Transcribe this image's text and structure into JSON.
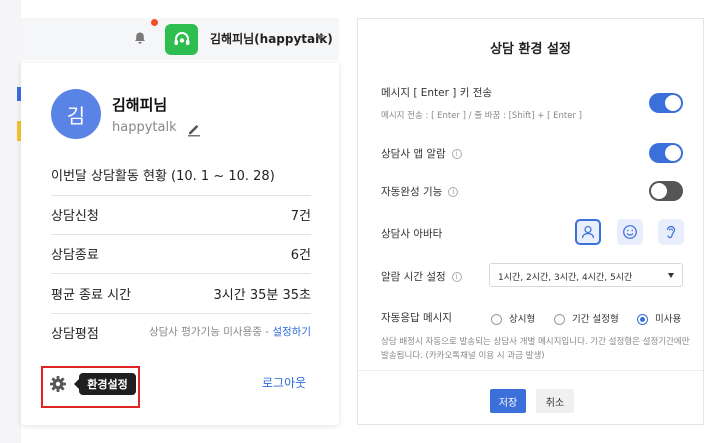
{
  "colors": {
    "accent": "#3b6fd9",
    "talk_green": "#2dbe4f",
    "notification_dot": "#f04e2a",
    "highlight_border": "#e02424",
    "link": "#2b6cd6"
  },
  "header": {
    "user_label": "김해피님(happytalk)",
    "notification_icon": "bell-icon",
    "logo_icon": "headset-icon"
  },
  "profile": {
    "avatar_text": "김",
    "name": "김해피님",
    "id": "happytalk",
    "activity_title": "이번달 상담활동 현황 (10. 1 ~ 10. 28)",
    "stats": [
      {
        "label": "상담신청",
        "value": "7건"
      },
      {
        "label": "상담종료",
        "value": "6건"
      },
      {
        "label": "평균 종료 시간",
        "value": "3시간 35분 35초"
      }
    ],
    "evaluation": {
      "label": "상담평점",
      "note": "상담사 평가기능 미사용중 - ",
      "link": "설정하기"
    },
    "settings_tooltip": "환경설정",
    "logout": "로그아웃"
  },
  "settings_modal": {
    "title": "상담 환경 설정",
    "enter_send": {
      "label": "메시지 [ Enter ] 키 전송",
      "sub": "메시지 전송 : [ Enter ] / 줄 바꿈 : [Shift] + [ Enter ]",
      "enabled": true
    },
    "app_alarm": {
      "label": "상담사 앱 알람",
      "enabled": true
    },
    "autocomplete": {
      "label": "자동완성 기능",
      "enabled": false
    },
    "avatar": {
      "label": "상담사 아바타",
      "options": [
        "person-avatar-icon",
        "smile-avatar-icon",
        "ear-avatar-icon"
      ],
      "selected": 0
    },
    "alarm_time": {
      "label": "알람 시간 설정",
      "value": "1시간, 2시간, 3시간, 4시간, 5시간"
    },
    "auto_reply": {
      "label": "자동응답 메시지",
      "options": [
        "상시형",
        "기간 설정형",
        "미사용"
      ],
      "selected": 2,
      "description": "상담 배정시 자동으로 발송되는 상담사 개별 메시지입니다. 기간 설정형은 설정기간에만 발송됩니다. (카카오톡채널 이용 시 과금 발생)"
    },
    "save_label": "저장",
    "cancel_label": "취소"
  }
}
